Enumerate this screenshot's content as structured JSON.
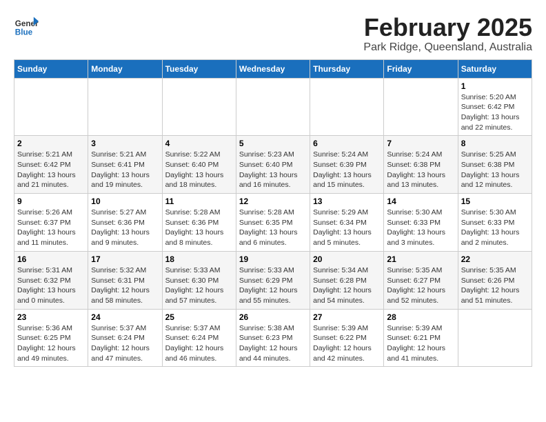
{
  "app": {
    "logo_general": "General",
    "logo_blue": "Blue",
    "title": "February 2025",
    "location": "Park Ridge, Queensland, Australia"
  },
  "calendar": {
    "days_of_week": [
      "Sunday",
      "Monday",
      "Tuesday",
      "Wednesday",
      "Thursday",
      "Friday",
      "Saturday"
    ],
    "weeks": [
      [
        {
          "day": "",
          "info": ""
        },
        {
          "day": "",
          "info": ""
        },
        {
          "day": "",
          "info": ""
        },
        {
          "day": "",
          "info": ""
        },
        {
          "day": "",
          "info": ""
        },
        {
          "day": "",
          "info": ""
        },
        {
          "day": "1",
          "info": "Sunrise: 5:20 AM\nSunset: 6:42 PM\nDaylight: 13 hours and 22 minutes."
        }
      ],
      [
        {
          "day": "2",
          "info": "Sunrise: 5:21 AM\nSunset: 6:42 PM\nDaylight: 13 hours and 21 minutes."
        },
        {
          "day": "3",
          "info": "Sunrise: 5:21 AM\nSunset: 6:41 PM\nDaylight: 13 hours and 19 minutes."
        },
        {
          "day": "4",
          "info": "Sunrise: 5:22 AM\nSunset: 6:40 PM\nDaylight: 13 hours and 18 minutes."
        },
        {
          "day": "5",
          "info": "Sunrise: 5:23 AM\nSunset: 6:40 PM\nDaylight: 13 hours and 16 minutes."
        },
        {
          "day": "6",
          "info": "Sunrise: 5:24 AM\nSunset: 6:39 PM\nDaylight: 13 hours and 15 minutes."
        },
        {
          "day": "7",
          "info": "Sunrise: 5:24 AM\nSunset: 6:38 PM\nDaylight: 13 hours and 13 minutes."
        },
        {
          "day": "8",
          "info": "Sunrise: 5:25 AM\nSunset: 6:38 PM\nDaylight: 13 hours and 12 minutes."
        }
      ],
      [
        {
          "day": "9",
          "info": "Sunrise: 5:26 AM\nSunset: 6:37 PM\nDaylight: 13 hours and 11 minutes."
        },
        {
          "day": "10",
          "info": "Sunrise: 5:27 AM\nSunset: 6:36 PM\nDaylight: 13 hours and 9 minutes."
        },
        {
          "day": "11",
          "info": "Sunrise: 5:28 AM\nSunset: 6:36 PM\nDaylight: 13 hours and 8 minutes."
        },
        {
          "day": "12",
          "info": "Sunrise: 5:28 AM\nSunset: 6:35 PM\nDaylight: 13 hours and 6 minutes."
        },
        {
          "day": "13",
          "info": "Sunrise: 5:29 AM\nSunset: 6:34 PM\nDaylight: 13 hours and 5 minutes."
        },
        {
          "day": "14",
          "info": "Sunrise: 5:30 AM\nSunset: 6:33 PM\nDaylight: 13 hours and 3 minutes."
        },
        {
          "day": "15",
          "info": "Sunrise: 5:30 AM\nSunset: 6:33 PM\nDaylight: 13 hours and 2 minutes."
        }
      ],
      [
        {
          "day": "16",
          "info": "Sunrise: 5:31 AM\nSunset: 6:32 PM\nDaylight: 13 hours and 0 minutes."
        },
        {
          "day": "17",
          "info": "Sunrise: 5:32 AM\nSunset: 6:31 PM\nDaylight: 12 hours and 58 minutes."
        },
        {
          "day": "18",
          "info": "Sunrise: 5:33 AM\nSunset: 6:30 PM\nDaylight: 12 hours and 57 minutes."
        },
        {
          "day": "19",
          "info": "Sunrise: 5:33 AM\nSunset: 6:29 PM\nDaylight: 12 hours and 55 minutes."
        },
        {
          "day": "20",
          "info": "Sunrise: 5:34 AM\nSunset: 6:28 PM\nDaylight: 12 hours and 54 minutes."
        },
        {
          "day": "21",
          "info": "Sunrise: 5:35 AM\nSunset: 6:27 PM\nDaylight: 12 hours and 52 minutes."
        },
        {
          "day": "22",
          "info": "Sunrise: 5:35 AM\nSunset: 6:26 PM\nDaylight: 12 hours and 51 minutes."
        }
      ],
      [
        {
          "day": "23",
          "info": "Sunrise: 5:36 AM\nSunset: 6:25 PM\nDaylight: 12 hours and 49 minutes."
        },
        {
          "day": "24",
          "info": "Sunrise: 5:37 AM\nSunset: 6:24 PM\nDaylight: 12 hours and 47 minutes."
        },
        {
          "day": "25",
          "info": "Sunrise: 5:37 AM\nSunset: 6:24 PM\nDaylight: 12 hours and 46 minutes."
        },
        {
          "day": "26",
          "info": "Sunrise: 5:38 AM\nSunset: 6:23 PM\nDaylight: 12 hours and 44 minutes."
        },
        {
          "day": "27",
          "info": "Sunrise: 5:39 AM\nSunset: 6:22 PM\nDaylight: 12 hours and 42 minutes."
        },
        {
          "day": "28",
          "info": "Sunrise: 5:39 AM\nSunset: 6:21 PM\nDaylight: 12 hours and 41 minutes."
        },
        {
          "day": "",
          "info": ""
        }
      ]
    ]
  }
}
